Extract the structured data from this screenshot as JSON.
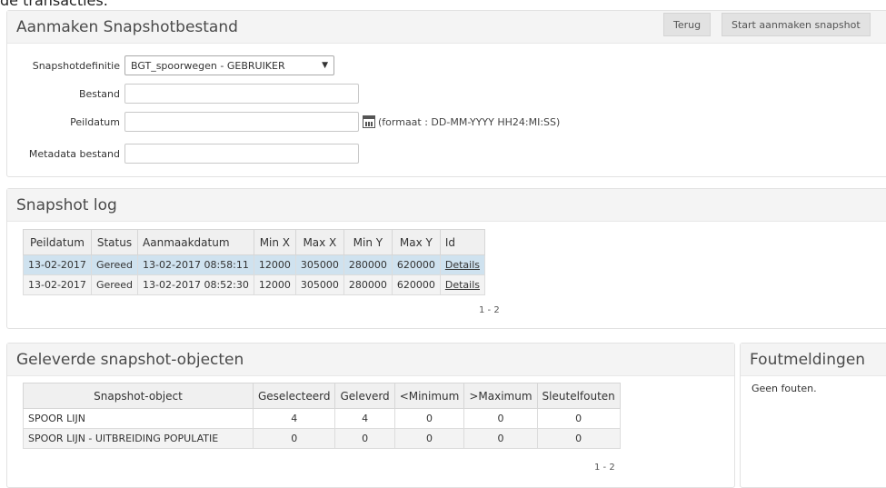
{
  "top_fragment": "de transacties.",
  "snapshot_panel": {
    "title": "Aanmaken Snapshotbestand",
    "back_button": "Terug",
    "start_button": "Start aanmaken snapshot",
    "fields": {
      "definitie_label": "Snapshotdefinitie",
      "definitie_value": "BGT_spoorwegen - GEBRUIKER",
      "bestand_label": "Bestand",
      "bestand_value": "",
      "peildatum_label": "Peildatum",
      "peildatum_value": "",
      "peildatum_hint": "(formaat : DD-MM-YYYY HH24:MI:SS)",
      "metadata_label": "Metadata bestand",
      "metadata_value": ""
    }
  },
  "log_panel": {
    "title": "Snapshot log",
    "headers": [
      "Peildatum",
      "Status",
      "Aanmaakdatum",
      "Min X",
      "Max X",
      "Min Y",
      "Max Y",
      "Id"
    ],
    "rows": [
      [
        "13-02-2017",
        "Gereed",
        "13-02-2017 08:58:11",
        "12000",
        "305000",
        "280000",
        "620000",
        "Details"
      ],
      [
        "13-02-2017",
        "Gereed",
        "13-02-2017 08:52:30",
        "12000",
        "305000",
        "280000",
        "620000",
        "Details"
      ]
    ],
    "pager": "1 - 2"
  },
  "objects_panel": {
    "title": "Geleverde snapshot-objecten",
    "headers": [
      "Snapshot-object",
      "Geselecteerd",
      "Geleverd",
      "<Minimum",
      ">Maximum",
      "Sleutelfouten"
    ],
    "rows": [
      [
        "SPOOR LIJN",
        "4",
        "4",
        "0",
        "0",
        "0"
      ],
      [
        "SPOOR LIJN - UITBREIDING POPULATIE",
        "0",
        "0",
        "0",
        "0",
        "0"
      ]
    ],
    "pager": "1 - 2"
  },
  "errors_panel": {
    "title": "Foutmeldingen",
    "message": "Geen fouten."
  }
}
